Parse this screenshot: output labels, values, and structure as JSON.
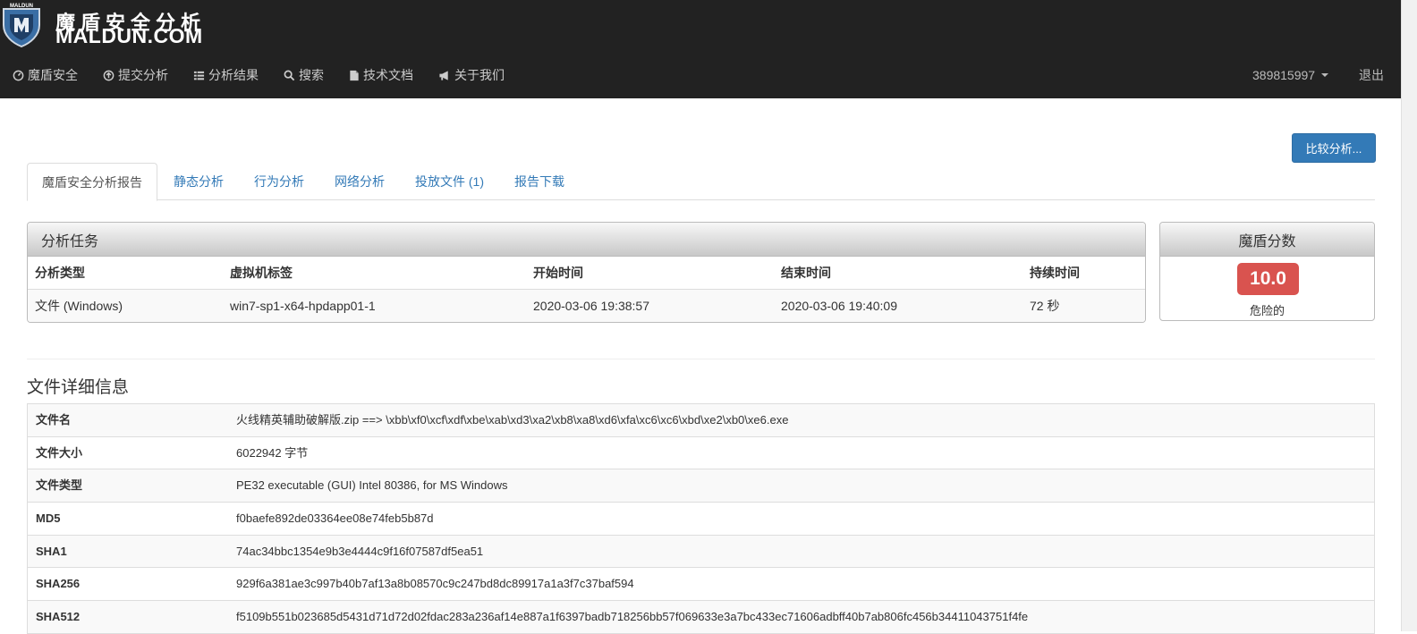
{
  "brand": {
    "name_cn": "魔盾安全分析",
    "name_en": "MALDUN.COM",
    "logo_text": "MALDUN"
  },
  "nav": [
    {
      "label": "魔盾安全",
      "icon": "dashboard-icon"
    },
    {
      "label": "提交分析",
      "icon": "upload-icon"
    },
    {
      "label": "分析结果",
      "icon": "list-icon"
    },
    {
      "label": "搜索",
      "icon": "search-icon"
    },
    {
      "label": "技术文档",
      "icon": "document-icon"
    },
    {
      "label": "关于我们",
      "icon": "bullhorn-icon"
    }
  ],
  "user": {
    "name": "389815997",
    "logout": "退出"
  },
  "compare_button": "比较分析...",
  "tabs": [
    "魔盾安全分析报告",
    "静态分析",
    "行为分析",
    "网络分析",
    "投放文件 (1)",
    "报告下载"
  ],
  "task": {
    "title": "分析任务",
    "columns": [
      "分析类型",
      "虚拟机标签",
      "开始时间",
      "结束时间",
      "持续时间"
    ],
    "values": [
      "文件 (Windows)",
      "win7-sp1-x64-hpdapp01-1",
      "2020-03-06 19:38:57",
      "2020-03-06 19:40:09",
      "72 秒"
    ]
  },
  "score": {
    "title": "魔盾分数",
    "value": "10.0",
    "label": "危险的",
    "badge_color": "#d9534f"
  },
  "file_details": {
    "title": "文件详细信息",
    "rows": [
      {
        "key": "文件名",
        "value": "火线精英辅助破解版.zip ==> \\xbb\\xf0\\xcf\\xdf\\xbe\\xab\\xd3\\xa2\\xb8\\xa8\\xd6\\xfa\\xc6\\xc6\\xbd\\xe2\\xb0\\xe6.exe"
      },
      {
        "key": "文件大小",
        "value": "6022942 字节"
      },
      {
        "key": "文件类型",
        "value": "PE32 executable (GUI) Intel 80386, for MS Windows"
      },
      {
        "key": "MD5",
        "value": "f0baefe892de03364ee08e74feb5b87d"
      },
      {
        "key": "SHA1",
        "value": "74ac34bbc1354e9b3e4444c9f16f07587df5ea51"
      },
      {
        "key": "SHA256",
        "value": "929f6a381ae3c997b40b7af13a8b08570c9c247bd8dc89917a1a3f7c37baf594"
      },
      {
        "key": "SHA512",
        "value": "f5109b551b023685d5431d71d72d02fdac283a236af14e887a1f6397badb718256bb57f069633e3a7bc433ec71606adbff40b7ab806fc456b34411043751f4fe"
      }
    ]
  },
  "colors": {
    "header_bg": "#222222",
    "link": "#337ab7",
    "primary_button": "#337ab7"
  }
}
